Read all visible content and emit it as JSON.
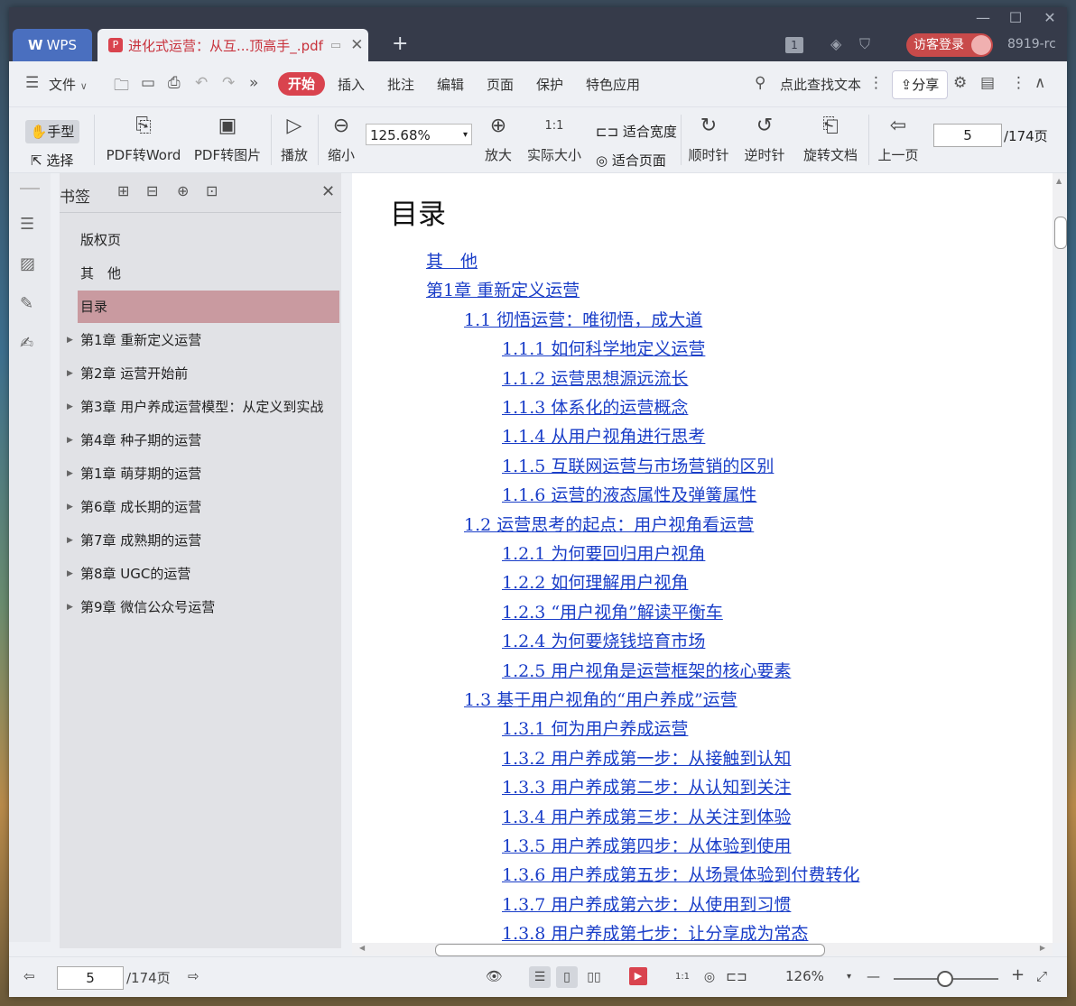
{
  "window": {
    "minimize_icon": "minimize-icon",
    "maximize_icon": "maximize-icon",
    "close_icon": "close-icon"
  },
  "tabs": [
    {
      "label": "WPS"
    },
    {
      "label": "进化式运营：从互...顶高手_.pdf"
    }
  ],
  "titlebar": {
    "badge": "1",
    "login_label": "访客登录",
    "user_label": "8919-rc"
  },
  "menu": {
    "file": "文件",
    "start": "开始",
    "items": [
      "插入",
      "批注",
      "编辑",
      "页面",
      "保护",
      "特色应用"
    ],
    "search": "点此查找文本",
    "share": "分享"
  },
  "toolbar": {
    "hand": "手型",
    "select": "选择",
    "pdf_word": "PDF转Word",
    "pdf_image": "PDF转图片",
    "play": "播放",
    "zoom_out": "缩小",
    "zoom_value": "125.68%",
    "zoom_in": "放大",
    "actual_size": "实际大小",
    "fit_width": "适合宽度",
    "fit_page": "适合页面",
    "clockwise": "顺时针",
    "counterclockwise": "逆时针",
    "rotate": "旋转文档",
    "prev_page": "上一页",
    "page": "5",
    "page_total": "/174页"
  },
  "bookmarks": {
    "title": "书签",
    "items": [
      {
        "label": "版权页",
        "expandable": false
      },
      {
        "label": "其　他",
        "expandable": false
      },
      {
        "label": "目录",
        "expandable": false,
        "active": true
      },
      {
        "label": "第1章 重新定义运营",
        "expandable": true
      },
      {
        "label": "第2章 运营开始前",
        "expandable": true
      },
      {
        "label": "第3章 用户养成运营模型：从定义到实战",
        "expandable": true
      },
      {
        "label": "第4章 种子期的运营",
        "expandable": true
      },
      {
        "label": "第1章 萌芽期的运营",
        "expandable": true
      },
      {
        "label": "第6章 成长期的运营",
        "expandable": true
      },
      {
        "label": "第7章 成熟期的运营",
        "expandable": true
      },
      {
        "label": "第8章 UGC的运营",
        "expandable": true
      },
      {
        "label": "第9章 微信公众号运营",
        "expandable": true
      }
    ]
  },
  "document": {
    "title": "目录",
    "toc": [
      {
        "text": "其　他",
        "level": 0
      },
      {
        "text": "第1章 重新定义运营",
        "level": 0
      },
      {
        "text": "1.1 彻悟运营：唯彻悟，成大道",
        "level": 1
      },
      {
        "text": "1.1.1 如何科学地定义运营",
        "level": 2
      },
      {
        "text": "1.1.2 运营思想源远流长",
        "level": 2
      },
      {
        "text": "1.1.3 体系化的运营概念",
        "level": 2
      },
      {
        "text": "1.1.4 从用户视角进行思考",
        "level": 2
      },
      {
        "text": "1.1.5 互联网运营与市场营销的区别",
        "level": 2
      },
      {
        "text": "1.1.6 运营的液态属性及弹簧属性",
        "level": 2
      },
      {
        "text": "1.2 运营思考的起点：用户视角看运营",
        "level": 1
      },
      {
        "text": "1.2.1 为何要回归用户视角",
        "level": 2
      },
      {
        "text": "1.2.2 如何理解用户视角",
        "level": 2
      },
      {
        "text": "1.2.3 “用户视角”解读平衡车",
        "level": 2
      },
      {
        "text": "1.2.4 为何要烧钱培育市场",
        "level": 2
      },
      {
        "text": "1.2.5 用户视角是运营框架的核心要素",
        "level": 2
      },
      {
        "text": "1.3 基于用户视角的“用户养成”运营",
        "level": 1
      },
      {
        "text": "1.3.1 何为用户养成运营",
        "level": 2
      },
      {
        "text": "1.3.2 用户养成第一步：从接触到认知",
        "level": 2
      },
      {
        "text": "1.3.3 用户养成第二步：从认知到关注",
        "level": 2
      },
      {
        "text": "1.3.4 用户养成第三步：从关注到体验",
        "level": 2
      },
      {
        "text": "1.3.5 用户养成第四步：从体验到使用",
        "level": 2
      },
      {
        "text": "1.3.6 用户养成第五步：从场景体验到付费转化",
        "level": 2
      },
      {
        "text": "1.3.7 用户养成第六步：从使用到习惯",
        "level": 2
      },
      {
        "text": "1.3.8 用户养成第七步：让分享成为常态",
        "level": 2
      }
    ]
  },
  "status": {
    "page": "5",
    "page_total": "/174页",
    "zoom": "126%"
  }
}
